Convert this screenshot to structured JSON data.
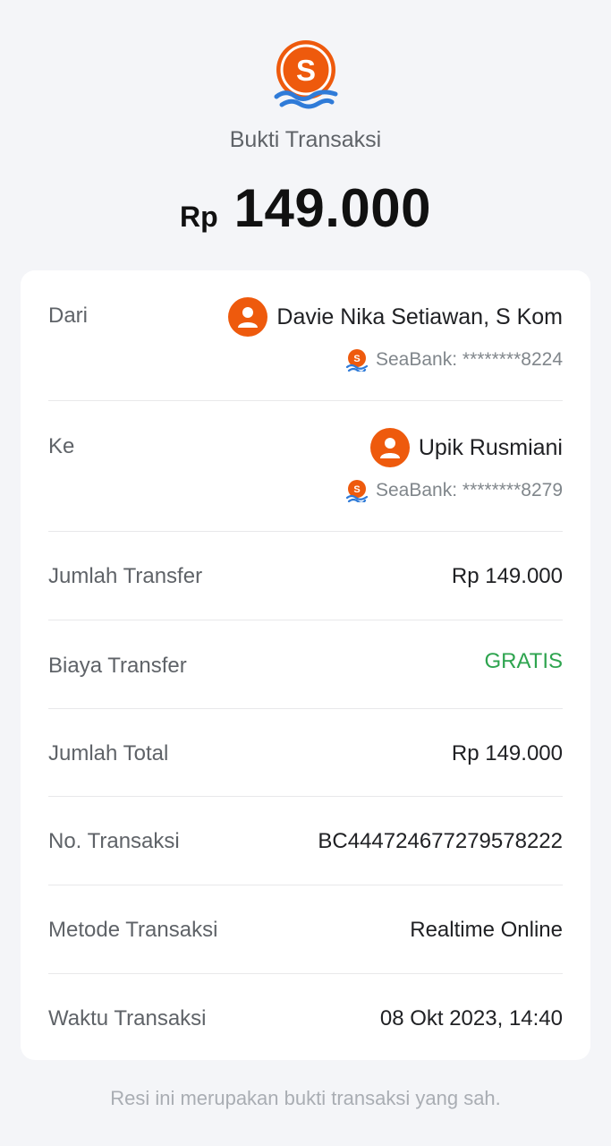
{
  "header": {
    "logo_icon": "seabank-logo-icon",
    "title": "Bukti Transaksi",
    "amount_currency": "Rp",
    "amount_value": "149.000"
  },
  "details": {
    "from": {
      "label": "Dari",
      "name": "Davie Nika Setiawan, S Kom",
      "bank": "SeaBank: ********8224",
      "avatar_icon": "user-avatar-icon"
    },
    "to": {
      "label": "Ke",
      "name": "Upik Rusmiani",
      "bank": "SeaBank: ********8279",
      "avatar_icon": "user-avatar-icon"
    },
    "transfer_amount": {
      "label": "Jumlah Transfer",
      "value": "Rp 149.000"
    },
    "transfer_fee": {
      "label": "Biaya Transfer",
      "value": "GRATIS"
    },
    "total_amount": {
      "label": "Jumlah Total",
      "value": "Rp 149.000"
    },
    "transaction_no": {
      "label": "No. Transaksi",
      "value": "BC444724677279578222"
    },
    "transaction_method": {
      "label": "Metode Transaksi",
      "value": "Realtime Online"
    },
    "transaction_time": {
      "label": "Waktu Transaksi",
      "value": "08 Okt 2023, 14:40"
    }
  },
  "footer": {
    "note": "Resi ini merupakan bukti transaksi yang sah."
  },
  "colors": {
    "brand_orange": "#ee5a0d",
    "brand_blue": "#2f7bd8",
    "free_green": "#2ea44f",
    "background": "#f4f5f8"
  }
}
